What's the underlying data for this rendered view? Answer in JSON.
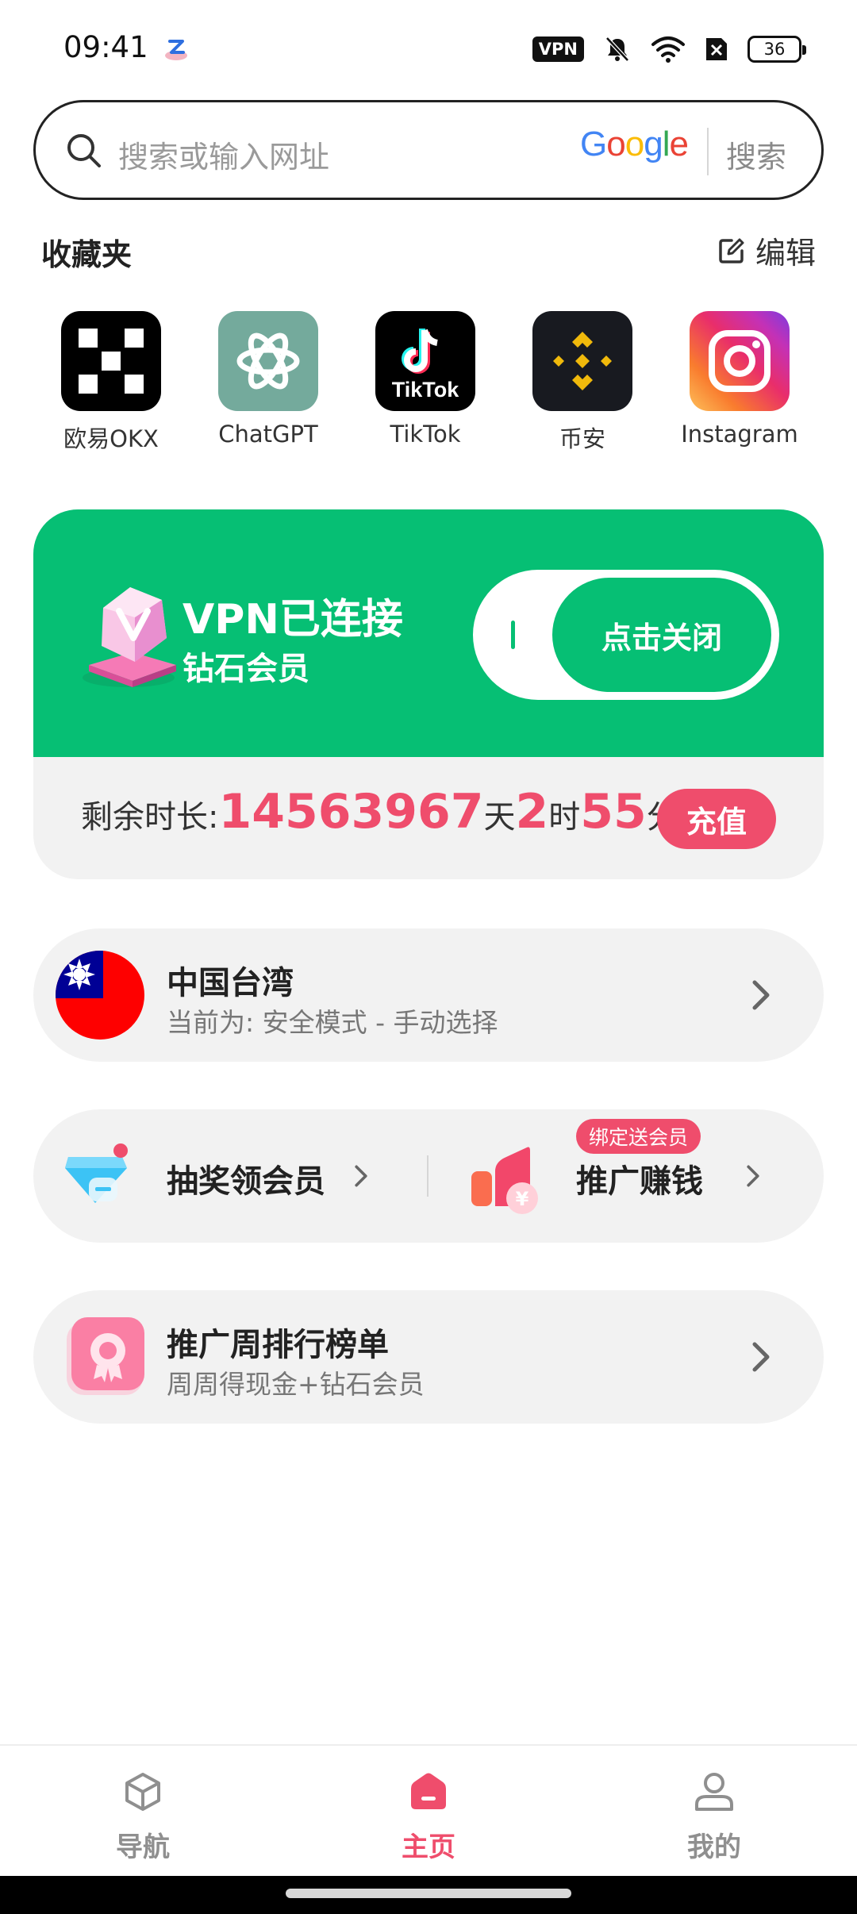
{
  "status_bar": {
    "time": "09:41",
    "vpn_badge": "VPN",
    "battery": "36"
  },
  "search": {
    "placeholder": "搜索或输入网址",
    "engine": "Google",
    "button": "搜索"
  },
  "favorites": {
    "title": "收藏夹",
    "edit_label": "编辑",
    "items": [
      {
        "label": "欧易OKX",
        "icon": "okx-icon"
      },
      {
        "label": "ChatGPT",
        "icon": "chatgpt-icon"
      },
      {
        "label": "TikTok",
        "icon": "tiktok-icon",
        "icon_text": "TikTok"
      },
      {
        "label": "币安",
        "icon": "binance-icon"
      },
      {
        "label": "Instagram",
        "icon": "instagram-icon"
      }
    ]
  },
  "vpn": {
    "status": "VPN已连接",
    "tier": "钻石会员",
    "toggle_label": "点击关闭",
    "remaining_label": "剩余时长:",
    "remaining_days": "14563967",
    "days_unit": "天",
    "remaining_hours": "2",
    "hours_unit": "时",
    "remaining_minutes": "55",
    "minutes_unit": "分",
    "recharge": "充值",
    "accent_color": "#06bf74"
  },
  "location": {
    "name": "中国台湾",
    "mode": "当前为: 安全模式 - 手动选择"
  },
  "promo": {
    "lottery": "抽奖领会员",
    "earn": "推广赚钱",
    "earn_badge": "绑定送会员"
  },
  "ranking": {
    "title": "推广周排行榜单",
    "subtitle": "周周得现金+钻石会员"
  },
  "nav": {
    "items": [
      {
        "label": "导航"
      },
      {
        "label": "主页"
      },
      {
        "label": "我的"
      }
    ],
    "active": "主页"
  },
  "colors": {
    "brand_green": "#06bf74",
    "accent_pink": "#ef4d6c",
    "card_gray": "#f2f2f2"
  }
}
